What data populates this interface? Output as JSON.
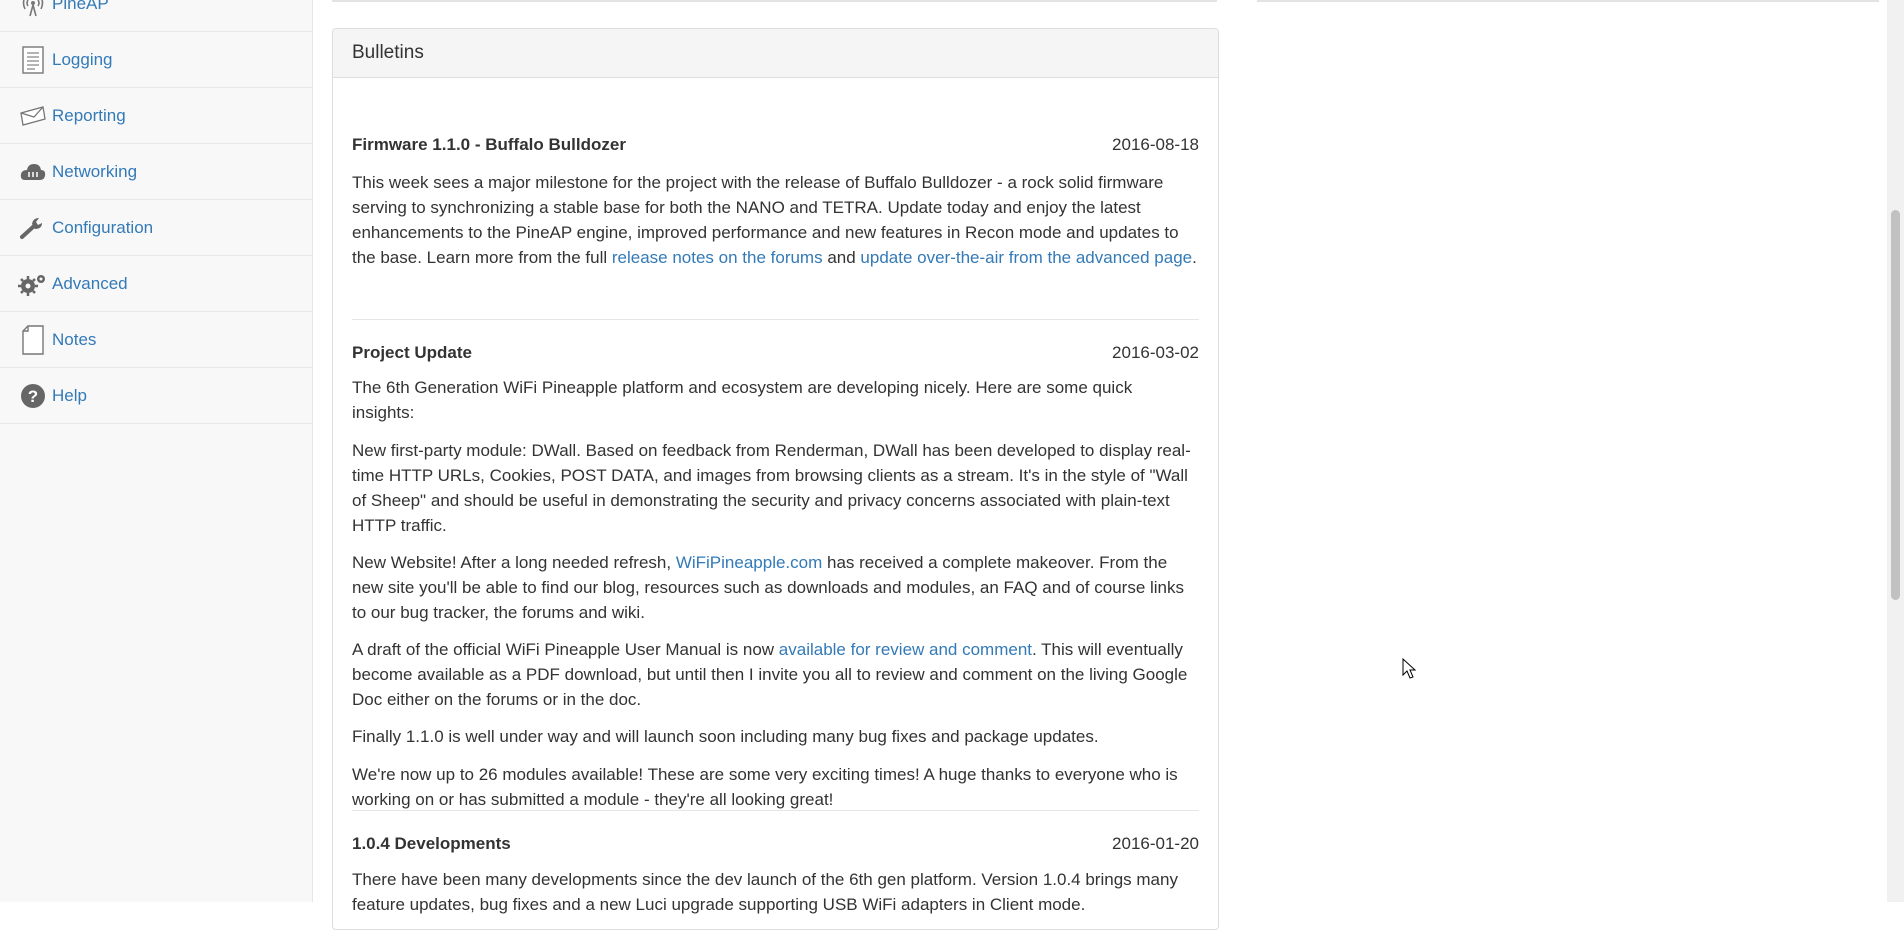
{
  "sidebar": {
    "items": [
      {
        "label": "PineAP",
        "icon": "antenna-icon"
      },
      {
        "label": "Logging",
        "icon": "log-document-icon"
      },
      {
        "label": "Reporting",
        "icon": "envelope-icon"
      },
      {
        "label": "Networking",
        "icon": "cloud-network-icon"
      },
      {
        "label": "Configuration",
        "icon": "wrench-icon"
      },
      {
        "label": "Advanced",
        "icon": "gears-icon"
      },
      {
        "label": "Notes",
        "icon": "note-page-icon"
      },
      {
        "label": "Help",
        "icon": "question-circle-icon"
      }
    ]
  },
  "bulletins": {
    "title": "Bulletins",
    "items": [
      {
        "title": "Firmware 1.1.0 - Buffalo Bulldozer",
        "date": "2016-08-18",
        "p1_text1": "This week sees a major milestone for the project with the release of Buffalo Bulldozer - a rock solid firmware serving to synchronizing a stable base for both the NANO and TETRA. Update today and enjoy the latest enhancements to the PineAP engine, improved performance and new features in Recon mode and updates to the base. Learn more from the full ",
        "p1_link1": "release notes on the forums",
        "p1_text2": " and ",
        "p1_link2": "update over-the-air from the advanced page",
        "p1_text3": "."
      },
      {
        "title": "Project Update",
        "date": "2016-03-02",
        "p1": "The 6th Generation WiFi Pineapple platform and ecosystem are developing nicely. Here are some quick insights:",
        "p2": "New first-party module: DWall. Based on feedback from Renderman, DWall has been developed to display real-time HTTP URLs, Cookies, POST DATA, and images from browsing clients as a stream. It's in the style of \"Wall of Sheep\" and should be useful in demonstrating the security and privacy concerns associated with plain-text HTTP traffic.",
        "p3_text1": "New Website! After a long needed refresh, ",
        "p3_link": "WiFiPineapple.com",
        "p3_text2": " has received a complete makeover. From the new site you'll be able to find our blog, resources such as downloads and modules, an FAQ and of course links to our bug tracker, the forums and wiki.",
        "p4_text1": "A draft of the official WiFi Pineapple User Manual is now ",
        "p4_link": "available for review and comment",
        "p4_text2": ". This will eventually become available as a PDF download, but until then I invite you all to review and comment on the living Google Doc either on the forums or in the doc.",
        "p5": "Finally 1.1.0 is well under way and will launch soon including many bug fixes and package updates.",
        "p6": "We're now up to 26 modules available! These are some very exciting times! A huge thanks to everyone who is working on or has submitted a module - they're all looking great!"
      },
      {
        "title": "1.0.4 Developments",
        "date": "2016-01-20",
        "p1": "There have been many developments since the dev launch of the 6th gen platform. Version 1.0.4 brings many feature updates, bug fixes and a new Luci upgrade supporting USB WiFi adapters in Client mode."
      }
    ]
  },
  "colors": {
    "link": "#337ab7",
    "text": "#333333",
    "sidebar_bg": "#f8f8f8"
  }
}
